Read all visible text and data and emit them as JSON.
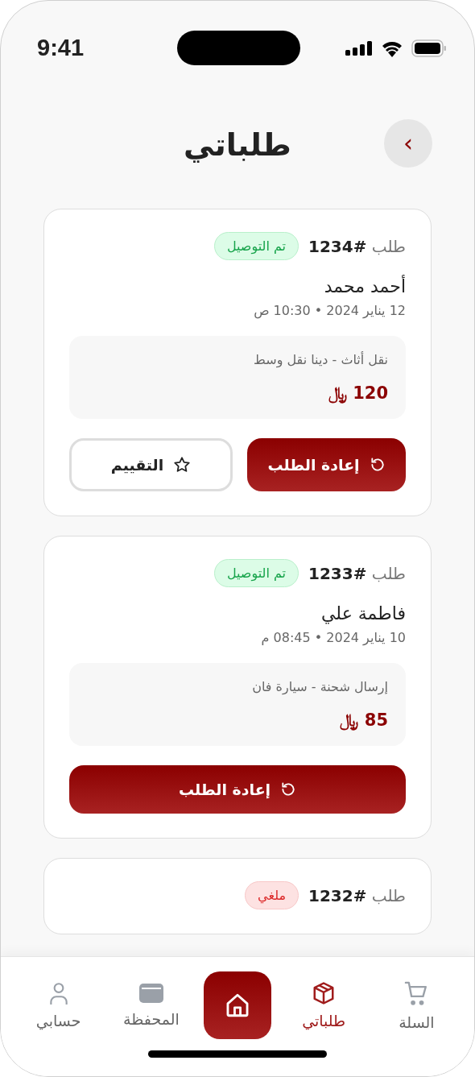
{
  "status_bar": {
    "time": "9:41"
  },
  "header": {
    "title": "طلباتي",
    "back": "›"
  },
  "orders": [
    {
      "number": "طلب **#1234**",
      "status": {
        "label": "تم التوصيل",
        "kind": "delivered"
      },
      "customer": "أحمد محمد",
      "datetime": "12 يناير 2024 • 10:30 ص",
      "service": "نقل أثاث - دينا نقل وسط",
      "price": "120",
      "currency": "﷼",
      "actions": [
        {
          "label": "إعادة الطلب",
          "kind": "reorder"
        },
        {
          "label": "التقييم",
          "kind": "rate"
        }
      ]
    },
    {
      "number": "طلب **#1233**",
      "status": {
        "label": "تم التوصيل",
        "kind": "delivered"
      },
      "customer": "فاطمة علي",
      "datetime": "10 يناير 2024 • 08:45 م",
      "service": "إرسال شحنة - سيارة فان",
      "price": "85",
      "currency": "﷼",
      "actions": [
        {
          "label": "إعادة الطلب",
          "kind": "reorder"
        }
      ]
    },
    {
      "number": "طلب **#1232**",
      "status": {
        "label": "ملغي",
        "kind": "cancelled"
      }
    }
  ],
  "nav": [
    {
      "label": "السلة",
      "kind": "cart",
      "selected": false
    },
    {
      "label": "طلباتي",
      "kind": "box",
      "selected": true
    },
    {
      "kind": "home",
      "selected": false
    },
    {
      "label": "المحفظة",
      "kind": "wallet",
      "selected": false
    },
    {
      "label": "حسابي",
      "kind": "person",
      "selected": false
    }
  ]
}
